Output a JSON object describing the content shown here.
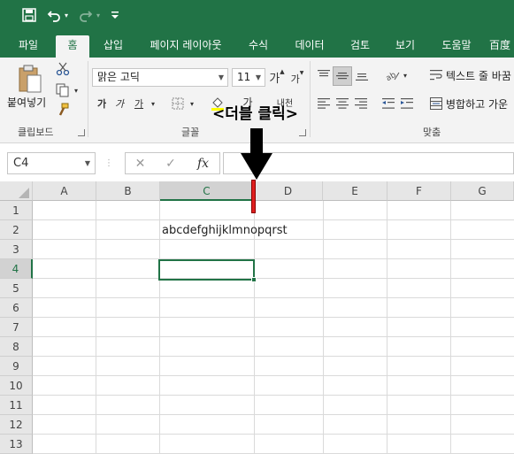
{
  "quick_access": {
    "save_icon": "save-icon",
    "undo_icon": "undo-icon",
    "redo_icon": "redo-icon",
    "customize_icon": "customize-icon"
  },
  "tabs": [
    {
      "label": "파일"
    },
    {
      "label": "홈"
    },
    {
      "label": "삽입"
    },
    {
      "label": "페이지 레이아웃"
    },
    {
      "label": "수식"
    },
    {
      "label": "데이터"
    },
    {
      "label": "검토"
    },
    {
      "label": "보기"
    },
    {
      "label": "도움말"
    },
    {
      "label": "百度"
    }
  ],
  "ribbon": {
    "clipboard": {
      "paste_label": "붙여넣기",
      "group_label": "클립보드"
    },
    "font": {
      "font_name": "맑은 고딕",
      "font_size": "11",
      "grow_label": "가",
      "shrink_label": "가",
      "bold_label": "가",
      "italic_label": "가",
      "underline_label": "가",
      "font_color_label": "가",
      "phonetic_label": "내천",
      "group_label": "글꼴"
    },
    "alignment": {
      "wrap_label": "텍스트 줄 바꿈",
      "merge_label": "병합하고 가운",
      "group_label": "맞춤"
    }
  },
  "formula_bar": {
    "name_box": "C4",
    "cancel_symbol": "✕",
    "enter_symbol": "✓",
    "fx_symbol": "fx",
    "formula_value": ""
  },
  "grid": {
    "columns": [
      "A",
      "B",
      "C",
      "D",
      "E",
      "F",
      "G"
    ],
    "rows": [
      "1",
      "2",
      "3",
      "4",
      "5",
      "6",
      "7",
      "8",
      "9",
      "10",
      "11",
      "12",
      "13"
    ],
    "selected_column": "C",
    "selected_row": "4",
    "cells": {
      "C2": "abcdefghijklmnopqrst"
    }
  },
  "annotation": {
    "text": "<더블 클릭>",
    "arrow_color": "#000000",
    "marker_color": "#e02020"
  },
  "colors": {
    "brand": "#217346",
    "ribbon_bg": "#f3f3f3",
    "header_bg": "#e6e6e6"
  }
}
